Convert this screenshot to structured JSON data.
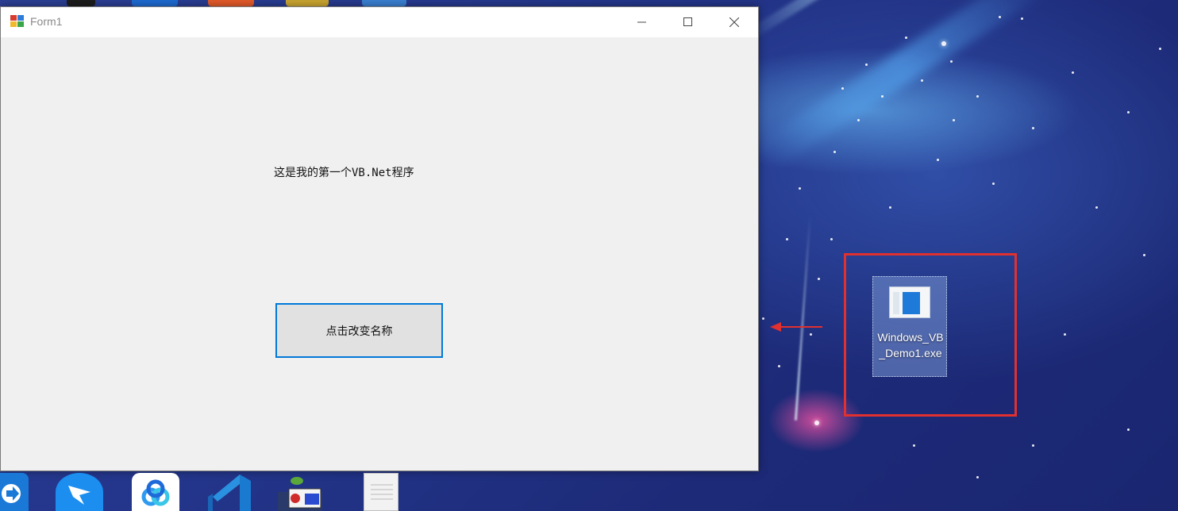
{
  "window": {
    "title": "Form1",
    "controls": {
      "minimize": "minimize",
      "maximize": "maximize",
      "close": "close"
    }
  },
  "form": {
    "label_text": "这是我的第一个VB.Net程序",
    "button_label": "点击改变名称"
  },
  "desktop": {
    "selected_icon_label": "Windows_VB_Demo1.exe",
    "annotation_color": "#e0302f",
    "icons": [
      "exe-file-icon"
    ]
  },
  "colors": {
    "accent": "#0078d7",
    "form_background": "#f0f0f0",
    "desktop_background": "#23358a"
  }
}
